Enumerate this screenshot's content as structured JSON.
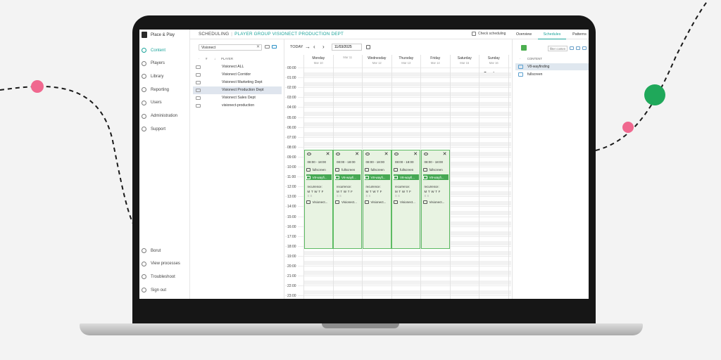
{
  "colors": {
    "accent": "#1aa39a",
    "event_bg": "#e8f3e2",
    "event_border": "#5dbb63",
    "highlight": "#45a853",
    "dot_pink": "#f0688f",
    "dot_green": "#1fa85a"
  },
  "brand": "Place & Play",
  "nav": {
    "top": [
      {
        "label": "Content",
        "icon": "content-icon"
      },
      {
        "label": "Players",
        "icon": "players-icon"
      },
      {
        "label": "Library",
        "icon": "library-icon"
      },
      {
        "label": "Reporting",
        "icon": "reporting-icon"
      },
      {
        "label": "Users",
        "icon": "users-icon"
      },
      {
        "label": "Administration",
        "icon": "administration-icon"
      },
      {
        "label": "Support",
        "icon": "support-icon"
      }
    ],
    "bottom": [
      {
        "label": "Borut",
        "icon": "user-icon"
      },
      {
        "label": "View processes",
        "icon": "processes-icon"
      },
      {
        "label": "Troubleshoot",
        "icon": "troubleshoot-icon"
      },
      {
        "label": "Sign out",
        "icon": "power-icon"
      }
    ]
  },
  "header": {
    "section": "SCHEDULING",
    "context": "PLAYER GROUP VISIONECT PRODUCTION DEPT",
    "check": "Check scheduling",
    "tabs": [
      "Overview",
      "Schedules",
      "Patterns"
    ]
  },
  "players": {
    "search_value": "Visionect",
    "cols": {
      "hash": "#",
      "sort": "↓",
      "player": "PLAYER"
    },
    "list": [
      "Visionect ALL",
      "Visionect Corridor",
      "Visionect Marketing Dept",
      "Visionect Production Dept",
      "Visionect Sales Dept",
      "visionect-production"
    ],
    "selected": "Visionect Production Dept"
  },
  "toolbar": {
    "today": "TODAY",
    "date": "11/03/2025"
  },
  "calendar": {
    "days": [
      {
        "name": "Monday",
        "date": "Mar 10"
      },
      {
        "name": "Tuesday",
        "date": "Mar 11"
      },
      {
        "name": "Wednesday",
        "date": "Mar 12"
      },
      {
        "name": "Thursday",
        "date": "Mar 13"
      },
      {
        "name": "Friday",
        "date": "Mar 14"
      },
      {
        "name": "Saturday",
        "date": "Mar 15"
      },
      {
        "name": "Sunday",
        "date": "Mar 16"
      }
    ],
    "hours": [
      "00:00",
      "01:00",
      "02:00",
      "03:00",
      "04:00",
      "05:00",
      "06:00",
      "07:00",
      "08:00",
      "09:00",
      "10:00",
      "11:00",
      "12:00",
      "13:00",
      "14:00",
      "15:00",
      "16:00",
      "17:00",
      "18:00",
      "19:00",
      "20:00",
      "21:00",
      "22:00",
      "23:00"
    ],
    "event": {
      "time": "08:00 - 18:00",
      "content1": "fullscreen",
      "content2": "V8-wayfi...",
      "recurrence_label": "recurrence:",
      "recurrence_days": "M T W T F",
      "recurrence_weekend": "S S",
      "player": "Visionect...",
      "day_count": 5
    }
  },
  "content": {
    "filter_placeholder": "filter content",
    "header": "CONTENT",
    "items": [
      "V8-wayfinding",
      "fullscreen"
    ]
  }
}
